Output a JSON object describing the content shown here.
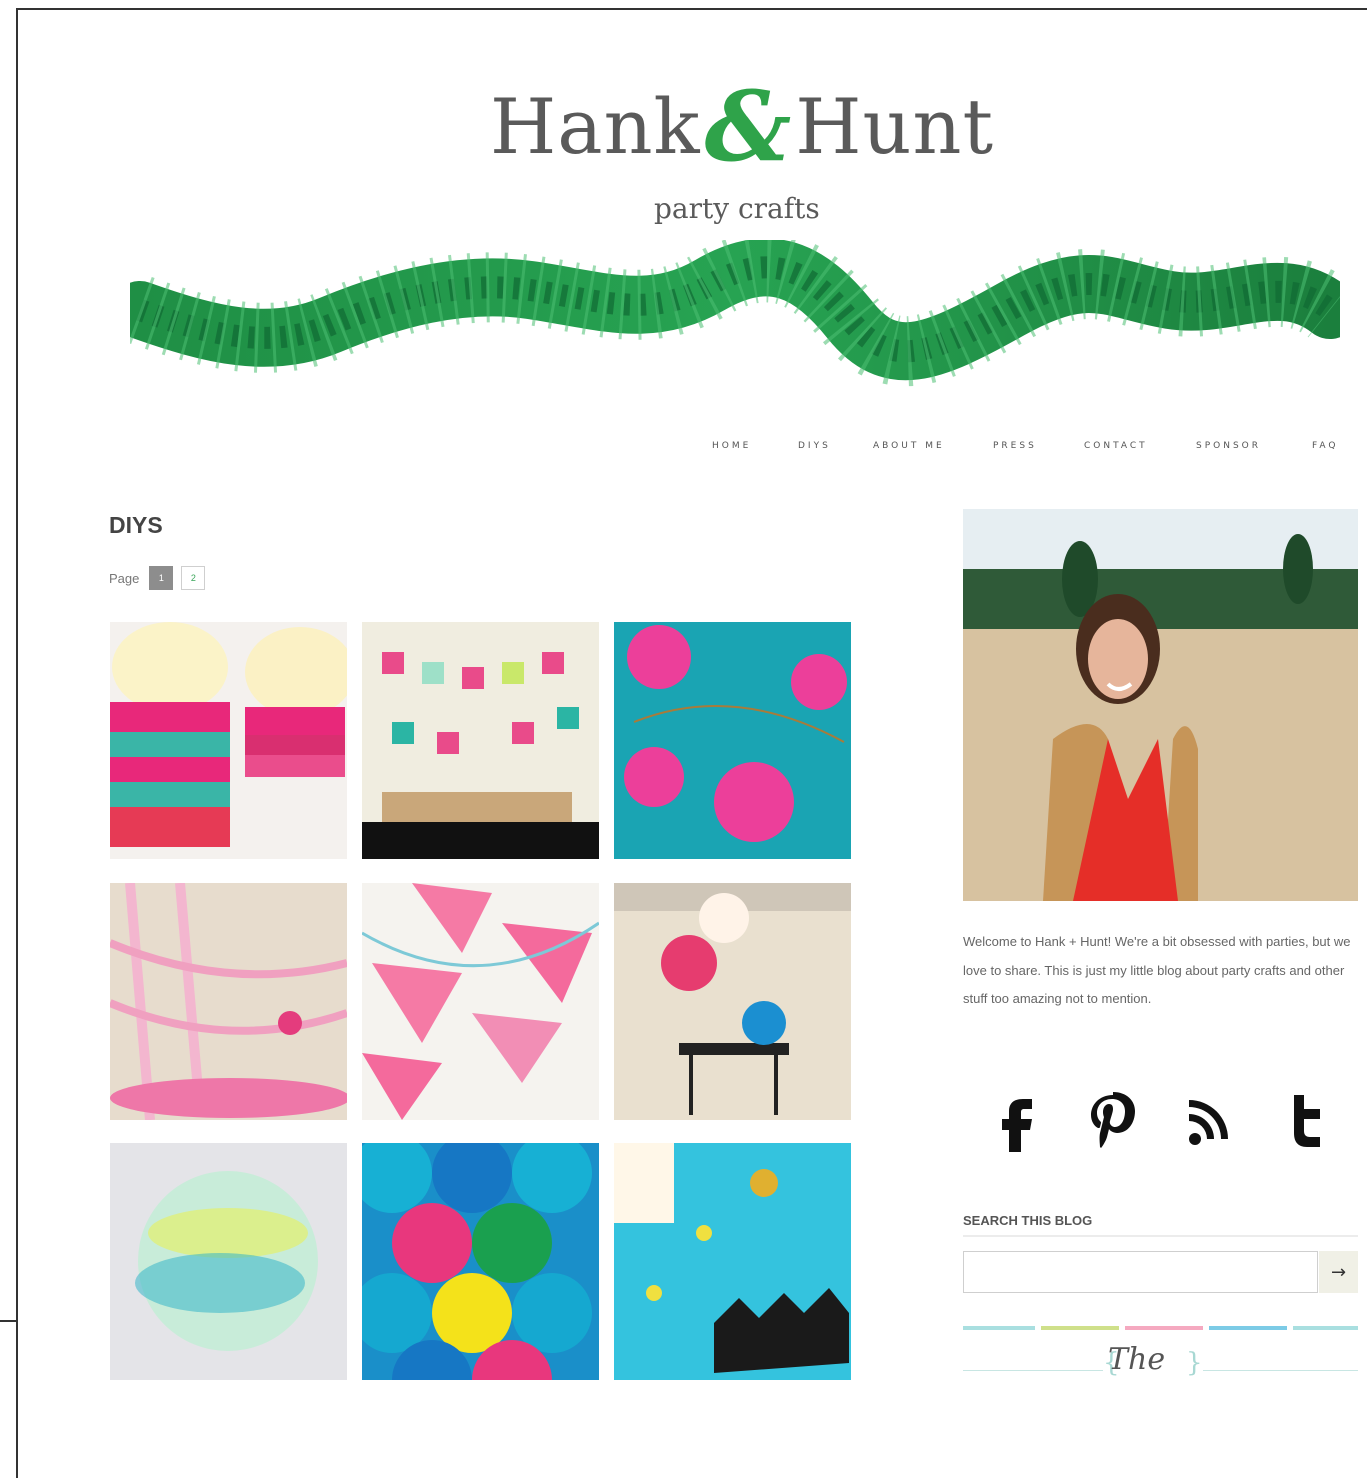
{
  "brand": {
    "name_left": "Hank",
    "ampersand": "&",
    "name_right": "Hunt",
    "tagline": "party crafts",
    "accent": "#2fa34a"
  },
  "nav": {
    "items": [
      "HOME",
      "DIYS",
      "ABOUT ME",
      "PRESS",
      "CONTACT",
      "SPONSOR",
      "FAQ"
    ]
  },
  "main": {
    "title": "DIYS",
    "pager": {
      "label": "Page",
      "pages": [
        "1",
        "2"
      ],
      "current": "1"
    },
    "tiles": [
      {
        "name": "tile-fringe-pinatas"
      },
      {
        "name": "tile-papel-picado-party"
      },
      {
        "name": "tile-paper-flower-garland"
      },
      {
        "name": "tile-pink-streamer-decor"
      },
      {
        "name": "tile-floral-bunting"
      },
      {
        "name": "tile-balloon-party"
      },
      {
        "name": "tile-watercolor-lantern"
      },
      {
        "name": "tile-paper-fan-wall"
      },
      {
        "name": "tile-hunter-crown-party"
      }
    ]
  },
  "sidebar": {
    "welcome": "Welcome to Hank + Hunt! We're a bit obsessed with parties, but we love to share. This is just my little blog about party crafts and other stuff too amazing not to mention.",
    "social": [
      "facebook-icon",
      "pinterest-icon",
      "rss-icon",
      "tumblr-icon"
    ],
    "search_title": "SEARCH THIS BLOG",
    "search_value": "",
    "search_button": "→",
    "badge_text": "The",
    "strip_colors": [
      "#a9dfe0",
      "#cfe08a",
      "#f5a9c0",
      "#7ccbe6",
      "#a9dfe0"
    ]
  }
}
